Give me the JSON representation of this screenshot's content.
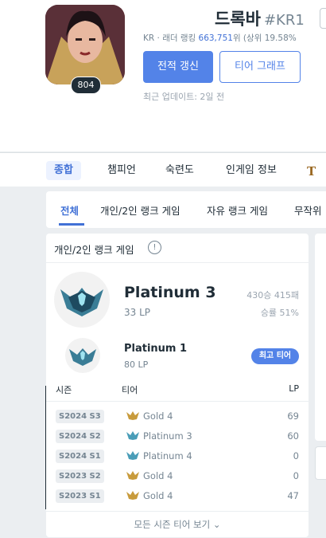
{
  "profile": {
    "level": "804",
    "name": "드록바",
    "tag": "#KR1",
    "ladder_prefix": "KR · 래더 랭킹",
    "ladder_rank": "663,751",
    "ladder_suffix": "위 (상위 19.58%",
    "refresh_label": "전적 갱신",
    "tier_graph_label": "티어 그래프",
    "last_updated": "최근 업데이트: 2일 전"
  },
  "nav": {
    "items": [
      "종합",
      "챔피언",
      "숙련도",
      "인게임 정보"
    ],
    "logo_glyph": "T"
  },
  "queues": [
    "전체",
    "개인/2인 랭크 게임",
    "자유 랭크 게임",
    "무작위"
  ],
  "ranked": {
    "title": "개인/2인 랭크 게임",
    "info_glyph": "!",
    "current": {
      "tier": "Platinum 3",
      "lp": "33 LP",
      "record": "430승 415패",
      "winrate": "승률 51%"
    },
    "peak": {
      "tier": "Platinum 1",
      "lp": "80 LP",
      "badge": "최고 티어"
    },
    "table": {
      "headers": {
        "season": "시즌",
        "tier": "티어",
        "lp": "LP"
      },
      "rows": [
        {
          "season": "S2024 S3",
          "tier": "Gold 4",
          "lp": "69",
          "icon": "gold-emblem"
        },
        {
          "season": "S2024 S2",
          "tier": "Platinum 3",
          "lp": "60",
          "icon": "platinum-emblem"
        },
        {
          "season": "S2024 S1",
          "tier": "Platinum 4",
          "lp": "0",
          "icon": "platinum-emblem"
        },
        {
          "season": "S2023 S2",
          "tier": "Gold 4",
          "lp": "0",
          "icon": "gold-emblem"
        },
        {
          "season": "S2023 S1",
          "tier": "Gold 4",
          "lp": "47",
          "icon": "gold-emblem"
        }
      ]
    },
    "more_label": "모든 시즌 티어 보기"
  },
  "colors": {
    "accent": "#5383e8",
    "gold": "#c89b3c",
    "platinum": "#4a9db8"
  }
}
